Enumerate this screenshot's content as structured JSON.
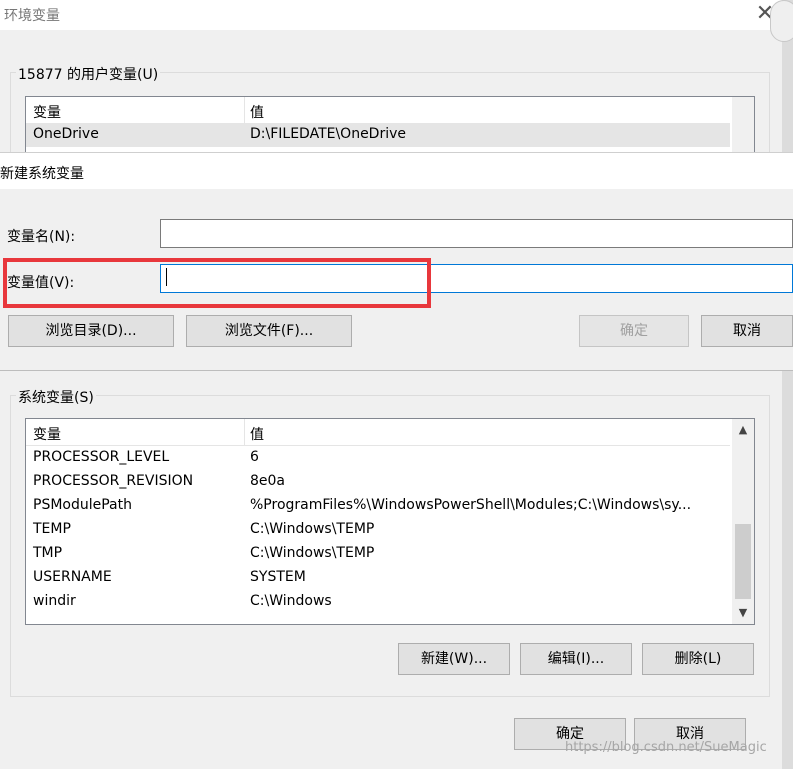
{
  "background_window": {
    "title": "环境变量",
    "close_glyph": "✕",
    "user_group": {
      "label": "15877 的用户变量(U)",
      "columns": [
        "变量",
        "值"
      ],
      "rows": [
        {
          "name": "OneDrive",
          "value": "D:\\FILEDATE\\OneDrive"
        }
      ]
    },
    "system_group": {
      "label": "系统变量(S)",
      "columns": [
        "变量",
        "值"
      ],
      "rows": [
        {
          "name": "PROCESSOR_LEVEL",
          "value": "6"
        },
        {
          "name": "PROCESSOR_REVISION",
          "value": "8e0a"
        },
        {
          "name": "PSModulePath",
          "value": "%ProgramFiles%\\WindowsPowerShell\\Modules;C:\\Windows\\sy..."
        },
        {
          "name": "TEMP",
          "value": "C:\\Windows\\TEMP"
        },
        {
          "name": "TMP",
          "value": "C:\\Windows\\TEMP"
        },
        {
          "name": "USERNAME",
          "value": "SYSTEM"
        },
        {
          "name": "windir",
          "value": "C:\\Windows"
        }
      ],
      "buttons": {
        "new": "新建(W)...",
        "edit": "编辑(I)...",
        "delete": "删除(L)"
      }
    },
    "footer_buttons": {
      "ok": "确定",
      "cancel": "取消"
    }
  },
  "dialog": {
    "title": "新建系统变量",
    "name_label": "变量名(N):",
    "name_value": "",
    "value_label": "变量值(V):",
    "value_value": "",
    "buttons": {
      "browse_dir": "浏览目录(D)...",
      "browse_file": "浏览文件(F)...",
      "ok": "确定",
      "cancel": "取消"
    },
    "ok_disabled": true
  },
  "annotation": {
    "color": "#e8373c"
  },
  "watermark": "https://blog.csdn.net/SueMagic",
  "colors": {
    "focus_border": "#0078d7",
    "window_bg": "#f0f0f0"
  }
}
